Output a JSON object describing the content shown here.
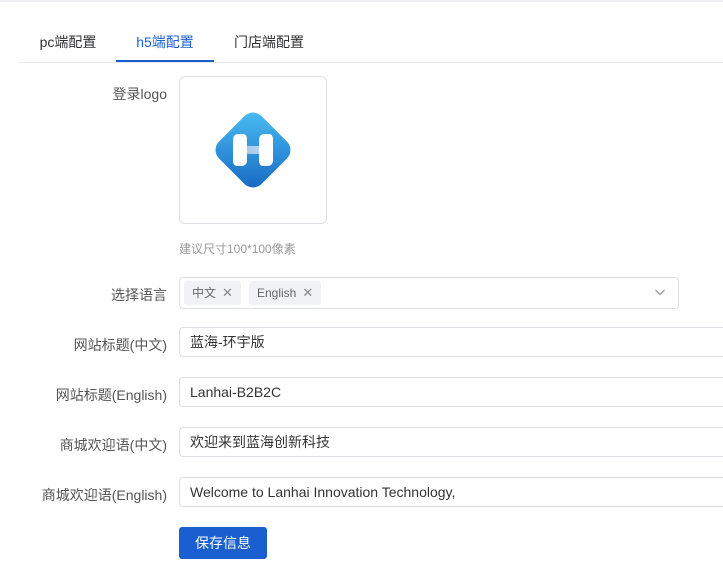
{
  "tabs": [
    {
      "label": "pc端配置",
      "active": false
    },
    {
      "label": "h5端配置",
      "active": true
    },
    {
      "label": "门店端配置",
      "active": false
    }
  ],
  "form": {
    "login_logo": {
      "label": "登录logo",
      "hint": "建议尺寸100*100像素",
      "icon": "lanhai-h-logo-icon"
    },
    "language": {
      "label": "选择语言",
      "tags": [
        "中文",
        "English"
      ]
    },
    "site_title_zh": {
      "label": "网站标题(中文)",
      "value": "蓝海-环宇版"
    },
    "site_title_en": {
      "label": "网站标题(English)",
      "value": "Lanhai-B2B2C"
    },
    "welcome_zh": {
      "label": "商城欢迎语(中文)",
      "value": "欢迎来到蓝海创新科技"
    },
    "welcome_en": {
      "label": "商城欢迎语(English)",
      "value": "Welcome to Lanhai Innovation Technology,"
    }
  },
  "save_label": "保存信息",
  "colors": {
    "accent": "#1a5fd0",
    "logo_light": "#3fa9ef",
    "logo_dark": "#1566c0"
  }
}
